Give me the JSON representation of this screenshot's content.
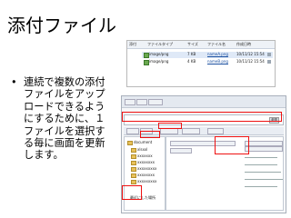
{
  "slide": {
    "title": "添付ファイル",
    "bullet_marker": "•",
    "bullet_text": "連続で複数の添付ファイルをアップロードできるようにするために、１ファイルを選択する毎に画面を更新します。"
  },
  "attachment_list": {
    "header": [
      "添付",
      "ファイルタイプ",
      "サイズ",
      "ファイル名",
      "作成日時"
    ],
    "rows": [
      {
        "type": "image/png",
        "size": "7 KB",
        "name": "nameA.png",
        "date": "10/11/12 15:54",
        "selected": true
      },
      {
        "type": "image/png",
        "size": "4 KB",
        "name": "nameB.png",
        "date": "10/11/12 15:54",
        "selected": false
      }
    ]
  },
  "upload_dialog": {
    "go_label": "参照",
    "tree_items": [
      "document",
      "xlsxxl",
      "xxxxxxx",
      "xxxxxxxx",
      "xxxxxxxxx",
      "xxxxxxxx",
      "xxxxxxxxx"
    ],
    "group_label": "最近にした場所"
  },
  "colors": {
    "highlight_red": "#ee1111",
    "selection_blue": "#dfe9f7",
    "header_bg": "#eef2f7"
  }
}
